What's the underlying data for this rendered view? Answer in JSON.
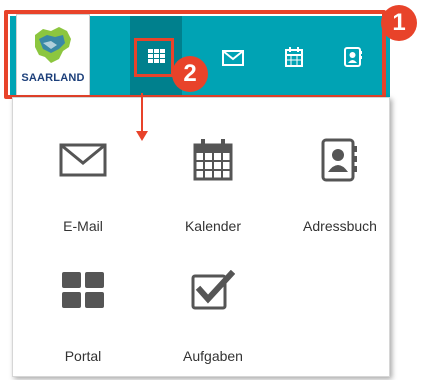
{
  "topbar": {
    "logo_text": "SAARLAND",
    "icons": [
      "apps-grid-icon",
      "mail-icon",
      "calendar-icon",
      "addressbook-icon"
    ]
  },
  "badges": {
    "one": "1",
    "two": "2"
  },
  "apps": {
    "email": {
      "label": "E-Mail",
      "icon": "mail-icon"
    },
    "calendar": {
      "label": "Kalender",
      "icon": "calendar-icon"
    },
    "addressbook": {
      "label": "Adressbuch",
      "icon": "addressbook-icon"
    },
    "portal": {
      "label": "Portal",
      "icon": "portal-icon"
    },
    "tasks": {
      "label": "Aufgaben",
      "icon": "tasks-icon"
    }
  },
  "colors": {
    "topbar": "#00a3b4",
    "topbar_active": "#00808d",
    "highlight": "#e8432a",
    "icon_gray": "#555555"
  }
}
